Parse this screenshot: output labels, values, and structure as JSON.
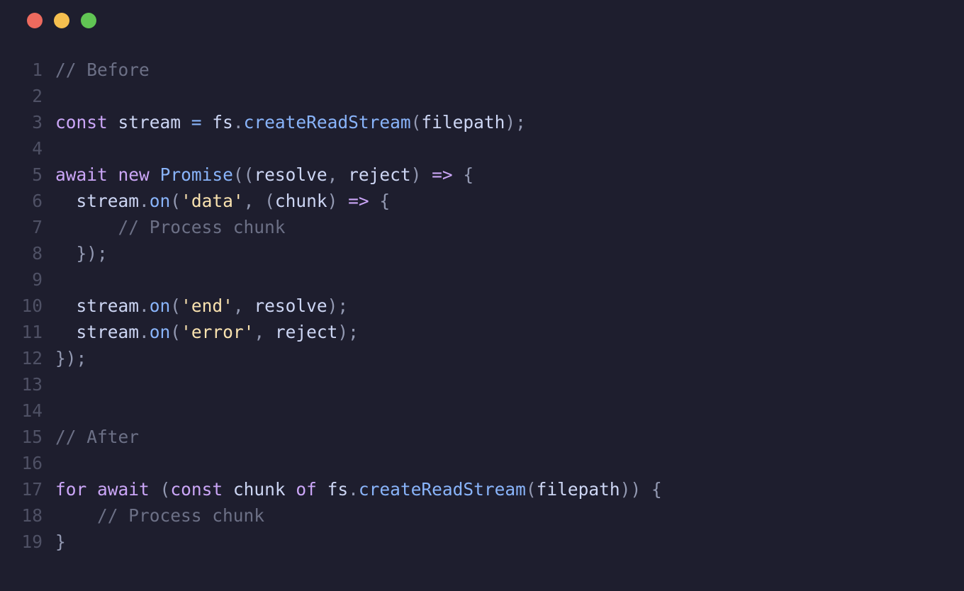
{
  "window": {
    "traffic_lights": [
      "close",
      "minimize",
      "zoom"
    ]
  },
  "code": {
    "lines": [
      {
        "n": "1",
        "t": [
          {
            "c": "tok-comment",
            "s": "// Before"
          }
        ]
      },
      {
        "n": "2",
        "t": []
      },
      {
        "n": "3",
        "t": [
          {
            "c": "tok-keyword",
            "s": "const"
          },
          {
            "c": "tok-ident",
            "s": " stream "
          },
          {
            "c": "tok-op",
            "s": "="
          },
          {
            "c": "tok-ident",
            "s": " fs"
          },
          {
            "c": "tok-punct",
            "s": "."
          },
          {
            "c": "tok-func",
            "s": "createReadStream"
          },
          {
            "c": "tok-punct",
            "s": "("
          },
          {
            "c": "tok-ident",
            "s": "filepath"
          },
          {
            "c": "tok-punct",
            "s": ");"
          }
        ]
      },
      {
        "n": "4",
        "t": []
      },
      {
        "n": "5",
        "t": [
          {
            "c": "tok-keyword",
            "s": "await"
          },
          {
            "c": "tok-ident",
            "s": " "
          },
          {
            "c": "tok-keyword",
            "s": "new"
          },
          {
            "c": "tok-ident",
            "s": " "
          },
          {
            "c": "tok-func",
            "s": "Promise"
          },
          {
            "c": "tok-punct",
            "s": "(("
          },
          {
            "c": "tok-param",
            "s": "resolve"
          },
          {
            "c": "tok-punct",
            "s": ", "
          },
          {
            "c": "tok-param",
            "s": "reject"
          },
          {
            "c": "tok-punct",
            "s": ") "
          },
          {
            "c": "tok-arrow",
            "s": "=>"
          },
          {
            "c": "tok-punct",
            "s": " {"
          }
        ]
      },
      {
        "n": "6",
        "t": [
          {
            "c": "tok-ident",
            "s": "  stream"
          },
          {
            "c": "tok-punct",
            "s": "."
          },
          {
            "c": "tok-func",
            "s": "on"
          },
          {
            "c": "tok-punct",
            "s": "("
          },
          {
            "c": "tok-string",
            "s": "'data'"
          },
          {
            "c": "tok-punct",
            "s": ", ("
          },
          {
            "c": "tok-param",
            "s": "chunk"
          },
          {
            "c": "tok-punct",
            "s": ") "
          },
          {
            "c": "tok-arrow",
            "s": "=>"
          },
          {
            "c": "tok-punct",
            "s": " {"
          }
        ]
      },
      {
        "n": "7",
        "t": [
          {
            "c": "tok-ident",
            "s": "      "
          },
          {
            "c": "tok-comment",
            "s": "// Process chunk"
          }
        ]
      },
      {
        "n": "8",
        "t": [
          {
            "c": "tok-punct",
            "s": "  });"
          }
        ]
      },
      {
        "n": "9",
        "t": []
      },
      {
        "n": "10",
        "t": [
          {
            "c": "tok-ident",
            "s": "  stream"
          },
          {
            "c": "tok-punct",
            "s": "."
          },
          {
            "c": "tok-func",
            "s": "on"
          },
          {
            "c": "tok-punct",
            "s": "("
          },
          {
            "c": "tok-string",
            "s": "'end'"
          },
          {
            "c": "tok-punct",
            "s": ", "
          },
          {
            "c": "tok-ident",
            "s": "resolve"
          },
          {
            "c": "tok-punct",
            "s": ");"
          }
        ]
      },
      {
        "n": "11",
        "t": [
          {
            "c": "tok-ident",
            "s": "  stream"
          },
          {
            "c": "tok-punct",
            "s": "."
          },
          {
            "c": "tok-func",
            "s": "on"
          },
          {
            "c": "tok-punct",
            "s": "("
          },
          {
            "c": "tok-string",
            "s": "'error'"
          },
          {
            "c": "tok-punct",
            "s": ", "
          },
          {
            "c": "tok-ident",
            "s": "reject"
          },
          {
            "c": "tok-punct",
            "s": ");"
          }
        ]
      },
      {
        "n": "12",
        "t": [
          {
            "c": "tok-punct",
            "s": "});"
          }
        ]
      },
      {
        "n": "13",
        "t": []
      },
      {
        "n": "14",
        "t": []
      },
      {
        "n": "15",
        "t": [
          {
            "c": "tok-comment",
            "s": "// After"
          }
        ]
      },
      {
        "n": "16",
        "t": []
      },
      {
        "n": "17",
        "t": [
          {
            "c": "tok-keyword",
            "s": "for"
          },
          {
            "c": "tok-ident",
            "s": " "
          },
          {
            "c": "tok-keyword",
            "s": "await"
          },
          {
            "c": "tok-punct",
            "s": " ("
          },
          {
            "c": "tok-keyword",
            "s": "const"
          },
          {
            "c": "tok-ident",
            "s": " chunk "
          },
          {
            "c": "tok-keyword",
            "s": "of"
          },
          {
            "c": "tok-ident",
            "s": " fs"
          },
          {
            "c": "tok-punct",
            "s": "."
          },
          {
            "c": "tok-func",
            "s": "createReadStream"
          },
          {
            "c": "tok-punct",
            "s": "("
          },
          {
            "c": "tok-ident",
            "s": "filepath"
          },
          {
            "c": "tok-punct",
            "s": ")) {"
          }
        ]
      },
      {
        "n": "18",
        "t": [
          {
            "c": "tok-ident",
            "s": "    "
          },
          {
            "c": "tok-comment",
            "s": "// Process chunk"
          }
        ]
      },
      {
        "n": "19",
        "t": [
          {
            "c": "tok-punct",
            "s": "}"
          }
        ]
      }
    ]
  }
}
